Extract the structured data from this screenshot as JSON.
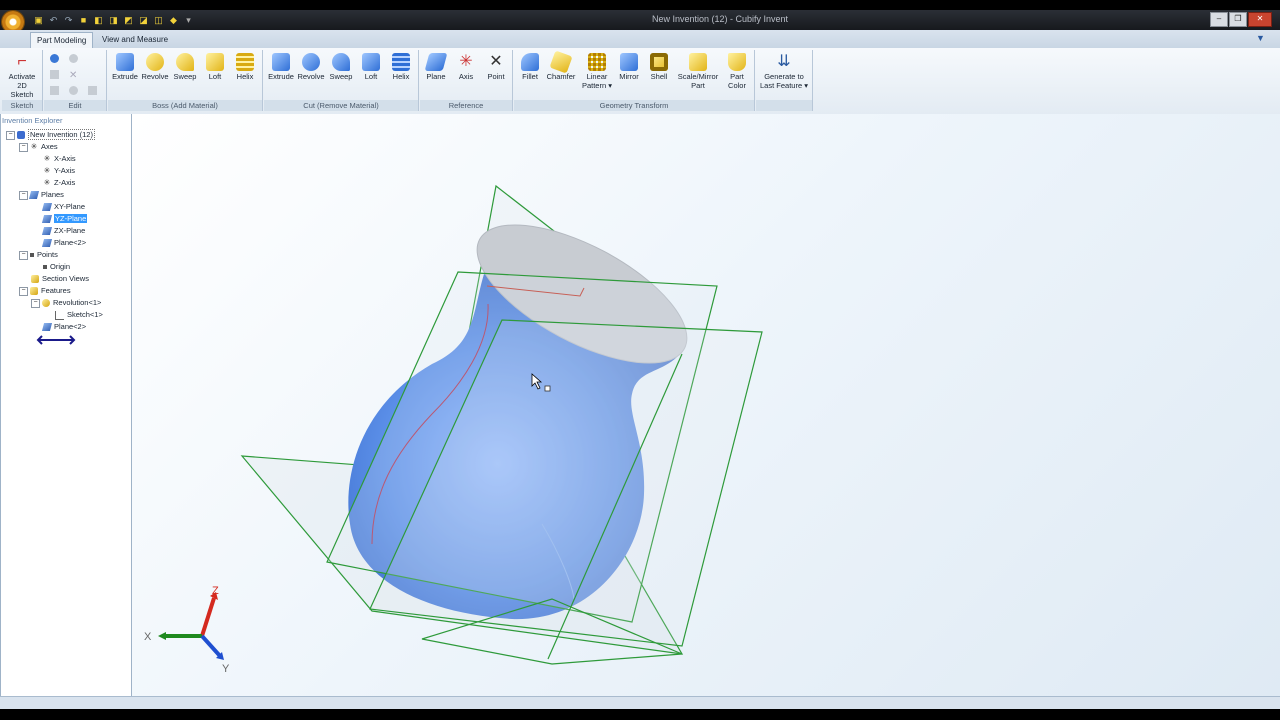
{
  "window": {
    "title": "New Invention (12) - Cubify Invent",
    "controls": [
      "minimize",
      "restore",
      "close"
    ]
  },
  "ribbon": {
    "tabs": [
      {
        "label": "Part Modeling",
        "active": true
      },
      {
        "label": "View and Measure",
        "active": false
      }
    ],
    "groups": {
      "sketch": {
        "label": "Sketch",
        "buttons": [
          "Activate 2D Sketch"
        ]
      },
      "edit": {
        "label": "Edit"
      },
      "boss": {
        "label": "Boss (Add Material)",
        "buttons": [
          "Extrude",
          "Revolve",
          "Sweep",
          "Loft",
          "Helix"
        ]
      },
      "cut": {
        "label": "Cut (Remove Material)",
        "buttons": [
          "Extrude",
          "Revolve",
          "Sweep",
          "Loft",
          "Helix"
        ]
      },
      "reference": {
        "label": "Reference",
        "buttons": [
          "Plane",
          "Axis",
          "Point"
        ]
      },
      "geometry": {
        "label": "Geometry Transform",
        "buttons": [
          "Fillet",
          "Chamfer",
          "Linear Pattern",
          "Mirror",
          "Shell",
          "Scale/Mirror Part",
          "Part Color"
        ]
      },
      "generate": {
        "buttons": [
          "Generate to Last Feature"
        ]
      }
    }
  },
  "explorer": {
    "title": "Invention Explorer",
    "root": "New Invention (12)",
    "axes": {
      "label": "Axes",
      "items": [
        "X-Axis",
        "Y-Axis",
        "Z-Axis"
      ]
    },
    "planes": {
      "label": "Planes",
      "items": [
        "XY-Plane",
        "YZ-Plane",
        "ZX-Plane",
        "Plane<2>"
      ],
      "selected": "YZ-Plane"
    },
    "points": {
      "label": "Points",
      "items": [
        "Origin"
      ]
    },
    "section_views": "Section Views",
    "features": {
      "label": "Features",
      "revolution": "Revolution<1>",
      "sketch": "Sketch<1>",
      "plane": "Plane<2>"
    }
  },
  "triad": {
    "x": "X",
    "y": "Y",
    "z": "Z",
    "x_color": "#1f8a1f",
    "y_color": "#1f4fd0",
    "z_color": "#d42a1f"
  },
  "colors": {
    "part": "#5b8fe8",
    "plane_outline": "#2e9a3a",
    "selection": "#3399ff"
  }
}
